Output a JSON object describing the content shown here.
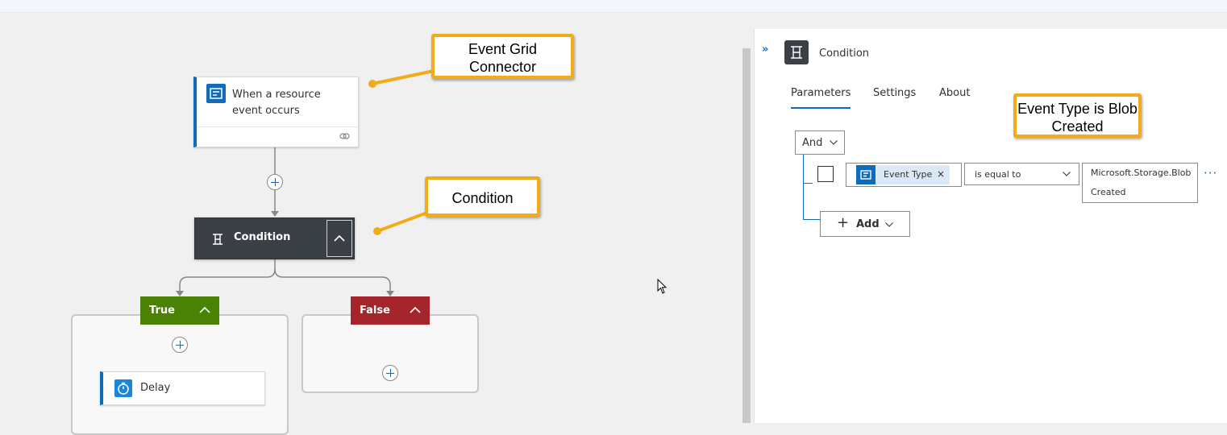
{
  "designer": {
    "trigger": {
      "title": "When a resource event occurs",
      "icon": "event-grid-icon"
    },
    "condition": {
      "label": "Condition",
      "icon": "condition-icon"
    },
    "true_branch": {
      "label": "True"
    },
    "false_branch": {
      "label": "False"
    },
    "delay": {
      "label": "Delay",
      "icon": "timer-icon"
    }
  },
  "callouts": {
    "event_grid": "Event Grid Connector",
    "condition": "Condition",
    "event_type": "Event Type is Blob Created"
  },
  "panel": {
    "title": "Condition",
    "tabs": [
      {
        "label": "Parameters",
        "active": true
      },
      {
        "label": "Settings",
        "active": false
      },
      {
        "label": "About",
        "active": false
      }
    ],
    "group_operator": "And",
    "row": {
      "left_token": "Event Type",
      "remove": "×",
      "operator": "is equal to",
      "value": "Microsoft.Storage.BlobCreated",
      "value_line1": "Microsoft.Storage.Blob",
      "value_line2": "Created",
      "more": "···"
    },
    "add_label": "Add",
    "expand": "»"
  },
  "colors": {
    "accent": "#0f6cbd",
    "true": "#498205",
    "false": "#a4262c",
    "condition_card": "#3b3f46",
    "callout_border": "#f2ac1b"
  }
}
